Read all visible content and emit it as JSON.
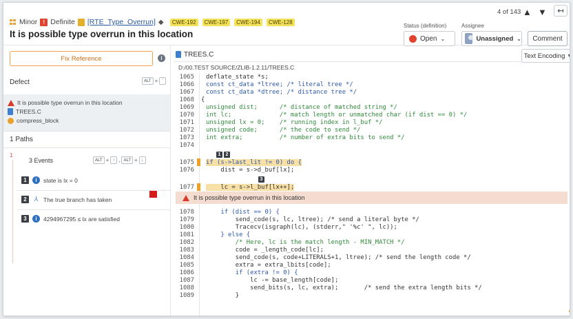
{
  "header": {
    "severity": "Minor",
    "certainty": "Definite",
    "checker": "[RTE_Type_Overrun]",
    "cwes": [
      "CWE-192",
      "CWE-197",
      "CWE-194",
      "CWE-128"
    ],
    "title": "It is possible type overrun in this location",
    "status_label": "Status (definition)",
    "status_value": "Open",
    "assignee_label": "Assignee",
    "assignee_value": "Unassigned",
    "comment_label": "Comment",
    "counter": "4 of 143"
  },
  "left": {
    "fix_reference": "Fix Reference",
    "defect_label": "Defect",
    "defect_rows": {
      "message": "It is possible type overrun in this location",
      "file": "TREES.C",
      "function": "compress_block"
    },
    "paths_label": "1 Paths",
    "path_index": "1",
    "events_label": "3 Events",
    "events": [
      {
        "num": "1",
        "text": "state is lx = 0"
      },
      {
        "num": "2",
        "text": "The true branch has taken"
      },
      {
        "num": "3",
        "text": "4294967295 ≤ lx are satisfied"
      }
    ],
    "kbd": {
      "alt": "ALT",
      "plus": "+",
      "up": "↑",
      "down": "↓",
      "backtick": "`",
      "comma": ","
    }
  },
  "right": {
    "tab_file": "TREES.C",
    "encoding_label": "Text Encoding",
    "path": "D:/00.TEST SOURCE/ZLIB-1.2.11/TREES.C",
    "banner": "It is possible type overrun in this location",
    "lines": [
      {
        "n": "1065",
        "code": "deflate_state *s;"
      },
      {
        "n": "1066",
        "code": "const ct_data *ltree; /* literal tree */"
      },
      {
        "n": "1067",
        "code": "const ct_data *dtree; /* distance tree */"
      },
      {
        "n": "1068",
        "code": "{"
      },
      {
        "n": "1069",
        "code": "unsigned dist;      /* distance of matched string */"
      },
      {
        "n": "1070",
        "code": "int lc;             /* match length or unmatched char (if dist == 0) */"
      },
      {
        "n": "1071",
        "code": "unsigned lx = 0;    /* running index in l_buf */"
      },
      {
        "n": "1072",
        "code": "unsigned code;      /* the code to send */"
      },
      {
        "n": "1073",
        "code": "int extra;          /* number of extra bits to send */"
      },
      {
        "n": "1074",
        "code": ""
      },
      {
        "n": "1075",
        "code": "if (s->last_lit != 0) do {"
      },
      {
        "n": "1076",
        "code": "    dist = s->d_buf[lx];"
      },
      {
        "n": "1077",
        "code": "    lc = s->l_buf[lx++];"
      },
      {
        "n": "1078",
        "code": "    if (dist == 0) {"
      },
      {
        "n": "1079",
        "code": "        send_code(s, lc, ltree); /* send a literal byte */"
      },
      {
        "n": "1080",
        "code": "        Tracecv(isgraph(lc), (stderr,\" '%c' \", lc));"
      },
      {
        "n": "1081",
        "code": "    } else {"
      },
      {
        "n": "1082",
        "code": "        /* Here, lc is the match length - MIN_MATCH */"
      },
      {
        "n": "1083",
        "code": "        code = _length_code[lc];"
      },
      {
        "n": "1084",
        "code": "        send_code(s, code+LITERALS+1, ltree); /* send the length code */"
      },
      {
        "n": "1085",
        "code": "        extra = extra_lbits[code];"
      },
      {
        "n": "1086",
        "code": "        if (extra != 0) {"
      },
      {
        "n": "1087",
        "code": "            lc -= base_length[code];"
      },
      {
        "n": "1088",
        "code": "            send_bits(s, lc, extra);       /* send the extra length bits */"
      },
      {
        "n": "1089",
        "code": "        }"
      }
    ]
  }
}
